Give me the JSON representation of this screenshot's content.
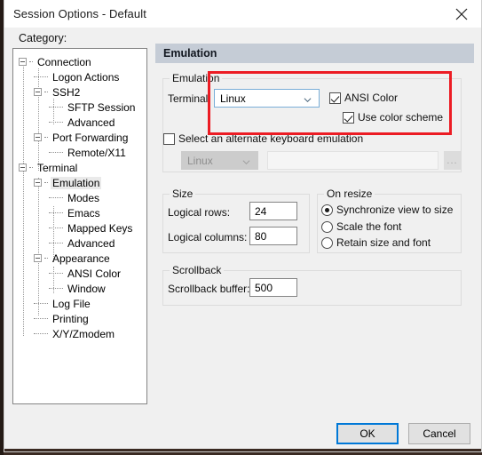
{
  "window": {
    "title": "Session Options - Default",
    "close_icon": "close-icon"
  },
  "left": {
    "category_label": "Category:",
    "tree": [
      {
        "label": "Connection",
        "depth": 0,
        "toggle": "minus",
        "selected": false
      },
      {
        "label": "Logon Actions",
        "depth": 1,
        "toggle": "none",
        "selected": false
      },
      {
        "label": "SSH2",
        "depth": 1,
        "toggle": "minus",
        "selected": false
      },
      {
        "label": "SFTP Session",
        "depth": 2,
        "toggle": "none",
        "selected": false
      },
      {
        "label": "Advanced",
        "depth": 2,
        "toggle": "none",
        "selected": false
      },
      {
        "label": "Port Forwarding",
        "depth": 1,
        "toggle": "minus",
        "selected": false
      },
      {
        "label": "Remote/X11",
        "depth": 2,
        "toggle": "none",
        "selected": false
      },
      {
        "label": "Terminal",
        "depth": 0,
        "toggle": "minus",
        "selected": false
      },
      {
        "label": "Emulation",
        "depth": 1,
        "toggle": "minus",
        "selected": true
      },
      {
        "label": "Modes",
        "depth": 2,
        "toggle": "none",
        "selected": false
      },
      {
        "label": "Emacs",
        "depth": 2,
        "toggle": "none",
        "selected": false
      },
      {
        "label": "Mapped Keys",
        "depth": 2,
        "toggle": "none",
        "selected": false
      },
      {
        "label": "Advanced",
        "depth": 2,
        "toggle": "none",
        "selected": false
      },
      {
        "label": "Appearance",
        "depth": 1,
        "toggle": "minus",
        "selected": false
      },
      {
        "label": "ANSI Color",
        "depth": 2,
        "toggle": "none",
        "selected": false
      },
      {
        "label": "Window",
        "depth": 2,
        "toggle": "none",
        "selected": false
      },
      {
        "label": "Log File",
        "depth": 1,
        "toggle": "none",
        "selected": false
      },
      {
        "label": "Printing",
        "depth": 1,
        "toggle": "none",
        "selected": false
      },
      {
        "label": "X/Y/Zmodem",
        "depth": 1,
        "toggle": "none",
        "selected": false
      }
    ]
  },
  "pane": {
    "header": "Emulation",
    "emulation_group": {
      "title": "Emulation",
      "terminal_label": "Terminal:",
      "terminal_value": "Linux",
      "ansi_color_label": "ANSI Color",
      "ansi_color_checked": "yes",
      "use_color_scheme_label": "Use color scheme",
      "use_color_scheme_checked": "yes",
      "alt_keyboard_label": "Select an alternate keyboard emulation",
      "alt_keyboard_checked": "no",
      "alt_keyboard_value": "Linux",
      "alt_keyboard_path": "",
      "browse_label": "..."
    },
    "size_group": {
      "title": "Size",
      "rows_label": "Logical rows:",
      "rows_value": "24",
      "cols_label": "Logical columns:",
      "cols_value": "80"
    },
    "resize_group": {
      "title": "On resize",
      "options": [
        {
          "label": "Synchronize view to size",
          "selected": true
        },
        {
          "label": "Scale the font",
          "selected": false
        },
        {
          "label": "Retain size and font",
          "selected": false
        }
      ]
    },
    "scrollback_group": {
      "title": "Scrollback",
      "buffer_label": "Scrollback buffer:",
      "buffer_value": "500"
    }
  },
  "footer": {
    "ok_label": "OK",
    "cancel_label": "Cancel"
  },
  "annotation": {
    "highlight_color": "#ec1c24"
  }
}
